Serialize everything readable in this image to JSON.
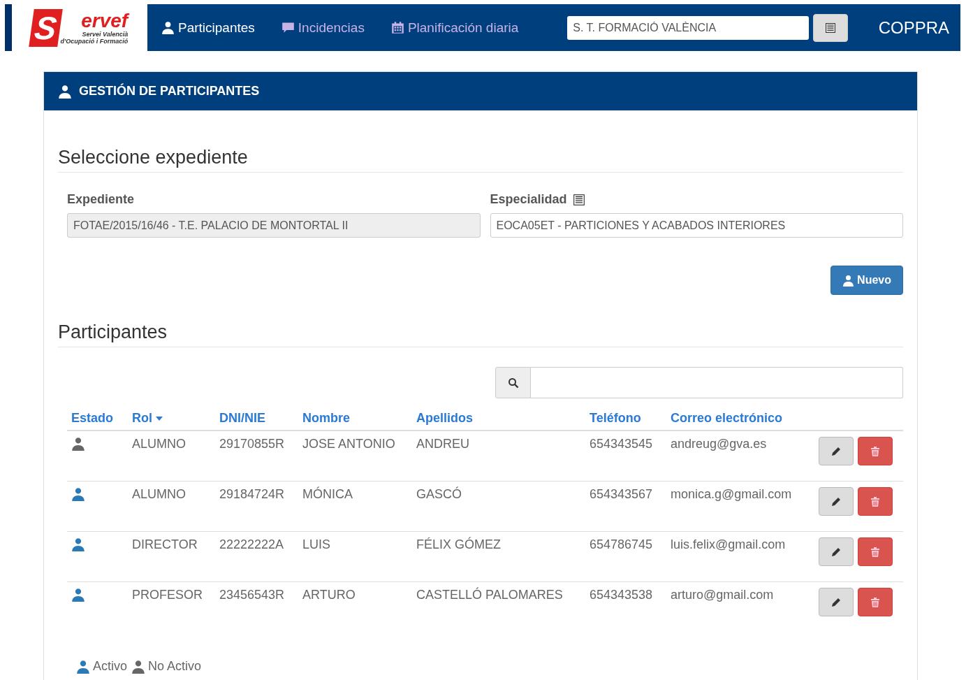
{
  "navbar": {
    "logo": {
      "letter": "S",
      "word": "ervef",
      "subtitle_1": "Servei Valencià",
      "subtitle_2": "d'Ocupació i Formació"
    },
    "items": [
      {
        "label": "Participantes",
        "selected": true
      },
      {
        "label": "Incidencias",
        "selected": false
      },
      {
        "label": "Planificación diaria",
        "selected": false
      }
    ],
    "center_field": {
      "value": "S. T. FORMACIÓ VALÈNCIA"
    },
    "app_name": "COPPRA"
  },
  "panel": {
    "title": "GESTIÓN DE PARTICIPANTES",
    "section_1": {
      "heading": "Seleccione expediente",
      "fields": [
        {
          "label": "Expediente",
          "value": "FOTAE/2015/16/46 - T.E. PALACIO DE MONTORTAL II",
          "disabled": true
        },
        {
          "label": "Especialidad",
          "value": "EOCA05ET - PARTICIONES Y ACABADOS INTERIORES",
          "disabled": false
        }
      ],
      "new_button": "Nuevo"
    },
    "section_2": {
      "heading": "Participantes",
      "table": {
        "columns": [
          {
            "label": "Estado",
            "sortable": false
          },
          {
            "label": "Rol",
            "sortable": true
          },
          {
            "label": "DNI/NIE",
            "sortable": false
          },
          {
            "label": "Nombre",
            "sortable": false
          },
          {
            "label": "Apellidos",
            "sortable": false
          },
          {
            "label": "Teléfono",
            "sortable": false
          },
          {
            "label": "Correo electrónico",
            "sortable": false
          }
        ],
        "rows": [
          {
            "active": false,
            "rol": "ALUMNO",
            "dni": "29170855R",
            "nombre": "JOSE ANTONIO",
            "apellidos": "ANDREU",
            "telefono": "654343545",
            "correo": "andreug@gva.es"
          },
          {
            "active": true,
            "rol": "ALUMNO",
            "dni": "29184724R",
            "nombre": "MÓNICA",
            "apellidos": "GASCÓ",
            "telefono": "654343567",
            "correo": "monica.g@gmail.com"
          },
          {
            "active": true,
            "rol": "DIRECTOR",
            "dni": "22222222A",
            "nombre": "LUIS",
            "apellidos": "FÉLIX GÓMEZ",
            "telefono": "654786745",
            "correo": "luis.felix@gmail.com"
          },
          {
            "active": true,
            "rol": "PROFESOR",
            "dni": "23456543R",
            "nombre": "ARTURO",
            "apellidos": "CASTELLÓ PALOMARES",
            "telefono": "654343538",
            "correo": "arturo@gmail.com"
          }
        ]
      },
      "legend": [
        {
          "label": "Activo",
          "active": true
        },
        {
          "label": "No Activo",
          "active": false
        }
      ]
    }
  }
}
